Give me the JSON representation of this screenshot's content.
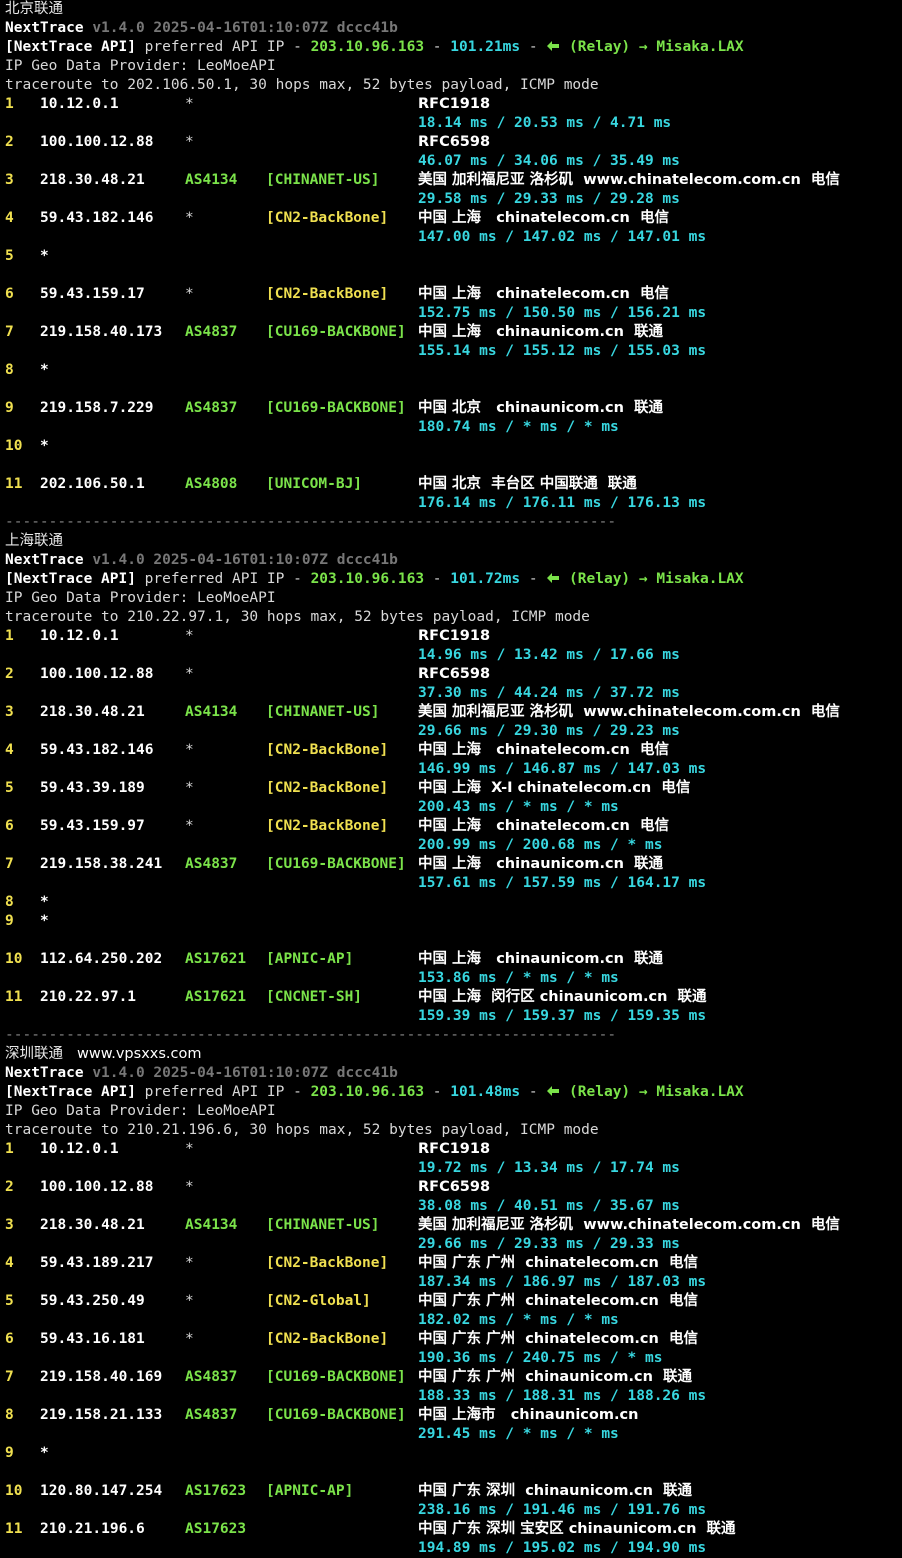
{
  "sections": [
    {
      "title": "北京联通",
      "watermark": "",
      "app_name": "NextTrace",
      "version": "v1.4.0 2025-04-16T01:10:07Z dccc41b",
      "api_tag": "[NextTrace API]",
      "api_text": " preferred API IP - ",
      "api_ip": "203.10.96.163",
      "api_dash": " - ",
      "api_latency": "101.21ms",
      "api_dash2": " - ",
      "relay": "(Relay) → Misaka.LAX",
      "geo_provider": "IP Geo Data Provider: LeoMoeAPI",
      "trace_cmd": "traceroute to 202.106.50.1, 30 hops max, 52 bytes payload, ICMP mode",
      "hops": [
        {
          "n": "1",
          "ip": "10.12.0.1",
          "asn": "*",
          "tag": "",
          "geo": "RFC1918",
          "rtt": "18.14 ms / 20.53 ms / 4.71 ms"
        },
        {
          "n": "2",
          "ip": "100.100.12.88",
          "asn": "*",
          "tag": "",
          "geo": "RFC6598",
          "rtt": "46.07 ms / 34.06 ms / 35.49 ms"
        },
        {
          "n": "3",
          "ip": "218.30.48.21",
          "asn": "AS4134",
          "tag": "[CHINANET-US]",
          "geo": "美国 加利福尼亚 洛杉矶  www.chinatelecom.com.cn  电信",
          "rtt": "29.58 ms / 29.33 ms / 29.28 ms"
        },
        {
          "n": "4",
          "ip": "59.43.182.146",
          "asn": "*",
          "tag": "[CN2-BackBone]",
          "geo": "中国 上海   chinatelecom.cn  电信",
          "rtt": "147.00 ms / 147.02 ms / 147.01 ms"
        },
        {
          "n": "5",
          "ip": "*",
          "asn": "",
          "tag": "",
          "geo": "",
          "rtt": ""
        },
        {
          "n": "6",
          "ip": "59.43.159.17",
          "asn": "*",
          "tag": "[CN2-BackBone]",
          "geo": "中国 上海   chinatelecom.cn  电信",
          "rtt": "152.75 ms / 150.50 ms / 156.21 ms"
        },
        {
          "n": "7",
          "ip": "219.158.40.173",
          "asn": "AS4837",
          "tag": "[CU169-BACKBONE]",
          "geo": "中国 上海   chinaunicom.cn  联通",
          "rtt": "155.14 ms / 155.12 ms / 155.03 ms"
        },
        {
          "n": "8",
          "ip": "*",
          "asn": "",
          "tag": "",
          "geo": "",
          "rtt": ""
        },
        {
          "n": "9",
          "ip": "219.158.7.229",
          "asn": "AS4837",
          "tag": "[CU169-BACKBONE]",
          "geo": "中国 北京   chinaunicom.cn  联通",
          "rtt": "180.74 ms / * ms / * ms"
        },
        {
          "n": "10",
          "ip": "*",
          "asn": "",
          "tag": "",
          "geo": "",
          "rtt": ""
        },
        {
          "n": "11",
          "ip": "202.106.50.1",
          "asn": "AS4808",
          "tag": "[UNICOM-BJ]",
          "geo": "中国 北京  丰台区 中国联通  联通",
          "rtt": "176.14 ms / 176.11 ms / 176.13 ms"
        }
      ],
      "separator": "----------------------------------------------------------------------"
    },
    {
      "title": "上海联通",
      "watermark": "",
      "app_name": "NextTrace",
      "version": "v1.4.0 2025-04-16T01:10:07Z dccc41b",
      "api_tag": "[NextTrace API]",
      "api_text": " preferred API IP - ",
      "api_ip": "203.10.96.163",
      "api_dash": " - ",
      "api_latency": "101.72ms",
      "api_dash2": " - ",
      "relay": "(Relay) → Misaka.LAX",
      "geo_provider": "IP Geo Data Provider: LeoMoeAPI",
      "trace_cmd": "traceroute to 210.22.97.1, 30 hops max, 52 bytes payload, ICMP mode",
      "hops": [
        {
          "n": "1",
          "ip": "10.12.0.1",
          "asn": "*",
          "tag": "",
          "geo": "RFC1918",
          "rtt": "14.96 ms / 13.42 ms / 17.66 ms"
        },
        {
          "n": "2",
          "ip": "100.100.12.88",
          "asn": "*",
          "tag": "",
          "geo": "RFC6598",
          "rtt": "37.30 ms / 44.24 ms / 37.72 ms"
        },
        {
          "n": "3",
          "ip": "218.30.48.21",
          "asn": "AS4134",
          "tag": "[CHINANET-US]",
          "geo": "美国 加利福尼亚 洛杉矶  www.chinatelecom.com.cn  电信",
          "rtt": "29.66 ms / 29.30 ms / 29.23 ms"
        },
        {
          "n": "4",
          "ip": "59.43.182.146",
          "asn": "*",
          "tag": "[CN2-BackBone]",
          "geo": "中国 上海   chinatelecom.cn  电信",
          "rtt": "146.99 ms / 146.87 ms / 147.03 ms"
        },
        {
          "n": "5",
          "ip": "59.43.39.189",
          "asn": "*",
          "tag": "[CN2-BackBone]",
          "geo": "中国 上海  X-I chinatelecom.cn  电信",
          "rtt": "200.43 ms / * ms / * ms"
        },
        {
          "n": "6",
          "ip": "59.43.159.97",
          "asn": "*",
          "tag": "[CN2-BackBone]",
          "geo": "中国 上海   chinatelecom.cn  电信",
          "rtt": "200.99 ms / 200.68 ms / * ms"
        },
        {
          "n": "7",
          "ip": "219.158.38.241",
          "asn": "AS4837",
          "tag": "[CU169-BACKBONE]",
          "geo": "中国 上海   chinaunicom.cn  联通",
          "rtt": "157.61 ms / 157.59 ms / 164.17 ms"
        },
        {
          "n": "8",
          "ip": "*",
          "asn": "",
          "tag": "",
          "geo": "",
          "rtt": "",
          "no_gap": true
        },
        {
          "n": "9",
          "ip": "*",
          "asn": "",
          "tag": "",
          "geo": "",
          "rtt": ""
        },
        {
          "n": "10",
          "ip": "112.64.250.202",
          "asn": "AS17621",
          "tag": "[APNIC-AP]",
          "geo": "中国 上海   chinaunicom.cn  联通",
          "rtt": "153.86 ms / * ms / * ms"
        },
        {
          "n": "11",
          "ip": "210.22.97.1",
          "asn": "AS17621",
          "tag": "[CNCNET-SH]",
          "geo": "中国 上海  闵行区 chinaunicom.cn  联通",
          "rtt": "159.39 ms / 159.37 ms / 159.35 ms"
        }
      ],
      "separator": "----------------------------------------------------------------------"
    },
    {
      "title": "深圳联通",
      "watermark": "www.vpsxxs.com",
      "app_name": "NextTrace",
      "version": "v1.4.0 2025-04-16T01:10:07Z dccc41b",
      "api_tag": "[NextTrace API]",
      "api_text": " preferred API IP - ",
      "api_ip": "203.10.96.163",
      "api_dash": " - ",
      "api_latency": "101.48ms",
      "api_dash2": " - ",
      "relay": "(Relay) → Misaka.LAX",
      "geo_provider": "IP Geo Data Provider: LeoMoeAPI",
      "trace_cmd": "traceroute to 210.21.196.6, 30 hops max, 52 bytes payload, ICMP mode",
      "hops": [
        {
          "n": "1",
          "ip": "10.12.0.1",
          "asn": "*",
          "tag": "",
          "geo": "RFC1918",
          "rtt": "19.72 ms / 13.34 ms / 17.74 ms"
        },
        {
          "n": "2",
          "ip": "100.100.12.88",
          "asn": "*",
          "tag": "",
          "geo": "RFC6598",
          "rtt": "38.08 ms / 40.51 ms / 35.67 ms"
        },
        {
          "n": "3",
          "ip": "218.30.48.21",
          "asn": "AS4134",
          "tag": "[CHINANET-US]",
          "geo": "美国 加利福尼亚 洛杉矶  www.chinatelecom.com.cn  电信",
          "rtt": "29.66 ms / 29.33 ms / 29.33 ms"
        },
        {
          "n": "4",
          "ip": "59.43.189.217",
          "asn": "*",
          "tag": "[CN2-BackBone]",
          "geo": "中国 广东 广州  chinatelecom.cn  电信",
          "rtt": "187.34 ms / 186.97 ms / 187.03 ms"
        },
        {
          "n": "5",
          "ip": "59.43.250.49",
          "asn": "*",
          "tag": "[CN2-Global]",
          "geo": "中国 广东 广州  chinatelecom.cn  电信",
          "rtt": "182.02 ms / * ms / * ms"
        },
        {
          "n": "6",
          "ip": "59.43.16.181",
          "asn": "*",
          "tag": "[CN2-BackBone]",
          "geo": "中国 广东 广州  chinatelecom.cn  电信",
          "rtt": "190.36 ms / 240.75 ms / * ms"
        },
        {
          "n": "7",
          "ip": "219.158.40.169",
          "asn": "AS4837",
          "tag": "[CU169-BACKBONE]",
          "geo": "中国 广东 广州  chinaunicom.cn  联通",
          "rtt": "188.33 ms / 188.31 ms / 188.26 ms"
        },
        {
          "n": "8",
          "ip": "219.158.21.133",
          "asn": "AS4837",
          "tag": "[CU169-BACKBONE]",
          "geo": "中国 上海市   chinaunicom.cn",
          "rtt": "291.45 ms / * ms / * ms"
        },
        {
          "n": "9",
          "ip": "*",
          "asn": "",
          "tag": "",
          "geo": "",
          "rtt": ""
        },
        {
          "n": "10",
          "ip": "120.80.147.254",
          "asn": "AS17623",
          "tag": "[APNIC-AP]",
          "geo": "中国 广东 深圳  chinaunicom.cn  联通",
          "rtt": "238.16 ms / 191.46 ms / 191.76 ms"
        },
        {
          "n": "11",
          "ip": "210.21.196.6",
          "asn": "AS17623",
          "tag": "",
          "geo": "中国 广东 深圳 宝安区 chinaunicom.cn  联通",
          "rtt": "194.89 ms / 195.02 ms / 194.90 ms"
        }
      ],
      "separator": ""
    }
  ],
  "colors": {
    "background": "#000000",
    "hop_number": "#f0e050",
    "asn": "#7be34a",
    "tag": "#f0e050",
    "rtt": "#38d7e0",
    "relay": "#7be34a"
  },
  "icons": {
    "relay": "relay-icon"
  }
}
